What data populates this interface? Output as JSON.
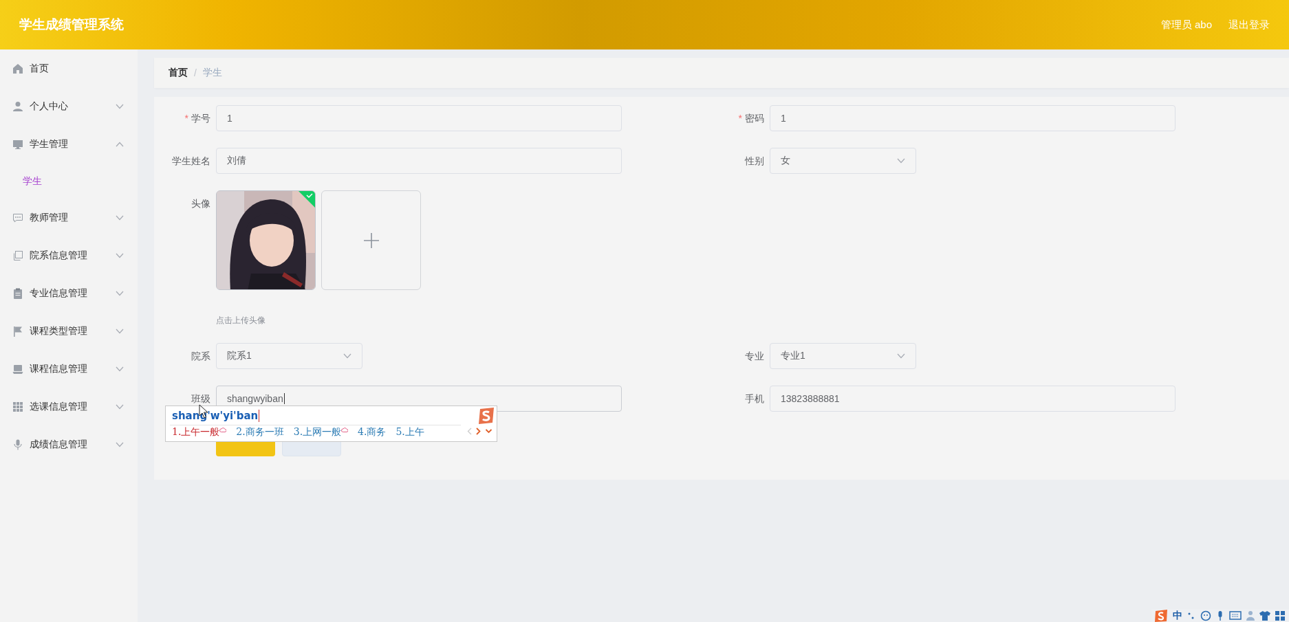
{
  "header": {
    "title": "学生成绩管理系统",
    "user": "管理员 abo",
    "logout": "退出登录"
  },
  "sidebar": {
    "items": [
      {
        "label": "首页",
        "kind": "link"
      },
      {
        "label": "个人中心",
        "kind": "menu",
        "expanded": false
      },
      {
        "label": "学生管理",
        "kind": "menu",
        "expanded": true,
        "children": [
          {
            "label": "学生",
            "selected": true
          }
        ]
      },
      {
        "label": "教师管理",
        "kind": "menu",
        "expanded": false
      },
      {
        "label": "院系信息管理",
        "kind": "menu",
        "expanded": false
      },
      {
        "label": "专业信息管理",
        "kind": "menu",
        "expanded": false
      },
      {
        "label": "课程类型管理",
        "kind": "menu",
        "expanded": false
      },
      {
        "label": "课程信息管理",
        "kind": "menu",
        "expanded": false
      },
      {
        "label": "选课信息管理",
        "kind": "menu",
        "expanded": false
      },
      {
        "label": "成绩信息管理",
        "kind": "menu",
        "expanded": false
      }
    ]
  },
  "breadcrumb": {
    "separator": "/",
    "items": [
      {
        "label": "首页",
        "current": false
      },
      {
        "label": "学生",
        "current": true
      }
    ]
  },
  "form": {
    "required_mark": "*",
    "fields": [
      {
        "label": "学号",
        "kind": "text",
        "required": true,
        "value": "1"
      },
      {
        "label": "密码",
        "kind": "text",
        "required": true,
        "value": "1"
      },
      {
        "label": "学生姓名",
        "kind": "text",
        "required": false,
        "value": "刘倩"
      },
      {
        "label": "性别",
        "kind": "select",
        "required": false,
        "value": "女"
      },
      {
        "label": "头像",
        "kind": "upload",
        "required": false,
        "uploaded": true,
        "hint": "点击上传头像"
      },
      {
        "label": "院系",
        "kind": "select",
        "required": false,
        "value": "院系1"
      },
      {
        "label": "专业",
        "kind": "select",
        "required": false,
        "value": "专业1"
      },
      {
        "label": "班级",
        "kind": "text",
        "required": false,
        "value": "shangwyiban",
        "focused": true
      },
      {
        "label": "手机",
        "kind": "text",
        "required": false,
        "value": "13823888881"
      }
    ],
    "buttons": [
      {
        "kind": "primary"
      },
      {
        "kind": "cancel"
      }
    ]
  },
  "ime": {
    "composition": "shang'w'yi'ban",
    "candidates": [
      {
        "label": "1.上午一般",
        "selected": true,
        "cloud": true
      },
      {
        "label": "2.商务一班",
        "selected": false,
        "cloud": false
      },
      {
        "label": "3.上网一般",
        "selected": false,
        "cloud": true
      },
      {
        "label": "4.商务",
        "selected": false,
        "cloud": false
      },
      {
        "label": "5.上午",
        "selected": false,
        "cloud": false
      }
    ]
  },
  "ime_status": {
    "mode": "中"
  }
}
